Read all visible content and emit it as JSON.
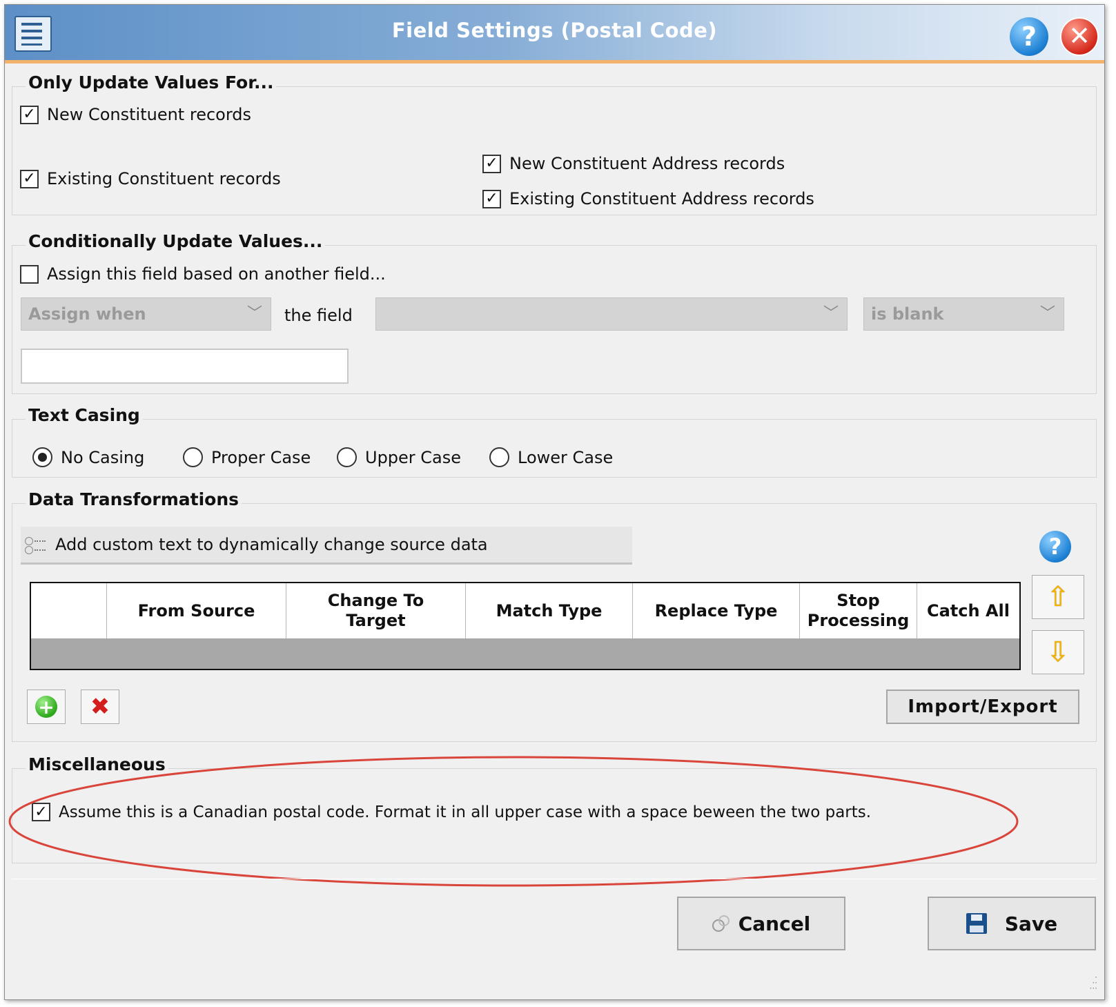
{
  "dialog": {
    "title": "Field Settings (Postal Code)"
  },
  "only_update": {
    "legend": "Only Update Values For...",
    "new_constituent": {
      "label": "New Constituent records",
      "checked": true
    },
    "existing_constituent": {
      "label": "Existing Constituent records",
      "checked": true
    },
    "new_address": {
      "label": "New Constituent Address records",
      "checked": true
    },
    "existing_address": {
      "label": "Existing Constituent Address records",
      "checked": true
    }
  },
  "conditional": {
    "legend": "Conditionally Update Values...",
    "assign_checkbox": {
      "label": "Assign this field based on another field...",
      "checked": false
    },
    "assign_when": "Assign when",
    "the_field_label": "the field",
    "field_value": "",
    "operator": "is blank",
    "value_input": ""
  },
  "text_casing": {
    "legend": "Text Casing",
    "options": [
      "No Casing",
      "Proper Case",
      "Upper Case",
      "Lower Case"
    ],
    "selected": "No Casing"
  },
  "transformations": {
    "legend": "Data Transformations",
    "custom_text": "Add custom text to dynamically change source data",
    "columns": [
      "From Source",
      "Change To Target",
      "Match Type",
      "Replace Type",
      "Stop Processing",
      "Catch All"
    ],
    "import_export": "Import/Export"
  },
  "misc": {
    "legend": "Miscellaneous",
    "canadian": {
      "label": "Assume this is a Canadian postal code. Format it in all upper case with a space beween the two parts.",
      "checked": true
    }
  },
  "footer": {
    "cancel": "Cancel",
    "save": "Save"
  },
  "colors": {
    "accent_orange": "#f2b26b",
    "title_blue": "#5d90c7",
    "highlight_red": "#d9453a"
  }
}
